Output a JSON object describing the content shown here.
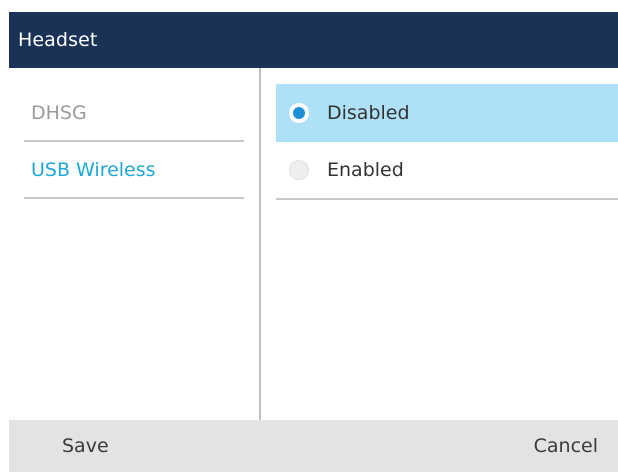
{
  "header": {
    "title": "Headset"
  },
  "sidebar": {
    "items": [
      {
        "label": "DHSG",
        "state": "inactive"
      },
      {
        "label": "USB Wireless",
        "state": "active"
      }
    ]
  },
  "options": {
    "items": [
      {
        "label": "Disabled",
        "selected": true
      },
      {
        "label": "Enabled",
        "selected": false
      }
    ]
  },
  "softkeys": {
    "save_label": "Save",
    "cancel_label": "Cancel"
  },
  "colors": {
    "title_bar": "#1b3257",
    "active_sidebar_text": "#1da8d8",
    "selected_row": "#aee1f7",
    "radio_fill": "#1d8fd6",
    "softkey_bar": "#e3e3e3"
  }
}
